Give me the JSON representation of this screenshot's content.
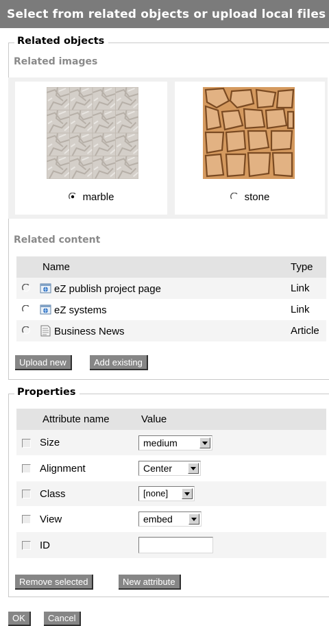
{
  "title": "Select from related objects or upload local files",
  "related_objects": {
    "legend": "Related objects",
    "images_heading": "Related images",
    "images": [
      {
        "name": "marble",
        "selected": true,
        "icon": "marble-texture-thumbnail"
      },
      {
        "name": "stone",
        "selected": false,
        "icon": "cracked-stone-texture-thumbnail"
      }
    ],
    "content_heading": "Related content",
    "columns": {
      "name": "Name",
      "type": "Type"
    },
    "rows": [
      {
        "name": "eZ publish project page",
        "type": "Link",
        "icon": "link-object-icon"
      },
      {
        "name": "eZ systems",
        "type": "Link",
        "icon": "link-object-icon"
      },
      {
        "name": "Business News",
        "type": "Article",
        "icon": "article-document-icon"
      }
    ],
    "buttons": {
      "upload_new": "Upload new",
      "add_existing": "Add existing"
    }
  },
  "properties": {
    "legend": "Properties",
    "columns": {
      "attribute": "Attribute name",
      "value": "Value"
    },
    "rows": [
      {
        "name": "Size",
        "value": "medium"
      },
      {
        "name": "Alignment",
        "value": "Center"
      },
      {
        "name": "Class",
        "value": "[none]"
      },
      {
        "name": "View",
        "value": "embed"
      },
      {
        "name": "ID",
        "value": ""
      }
    ],
    "buttons": {
      "remove_selected": "Remove selected",
      "new_attribute": "New attribute"
    }
  },
  "footer": {
    "ok": "OK",
    "cancel": "Cancel"
  },
  "colors": {
    "title_bar": "#7b7b7b",
    "button": "#868686",
    "muted_heading": "#8a8a8a"
  }
}
